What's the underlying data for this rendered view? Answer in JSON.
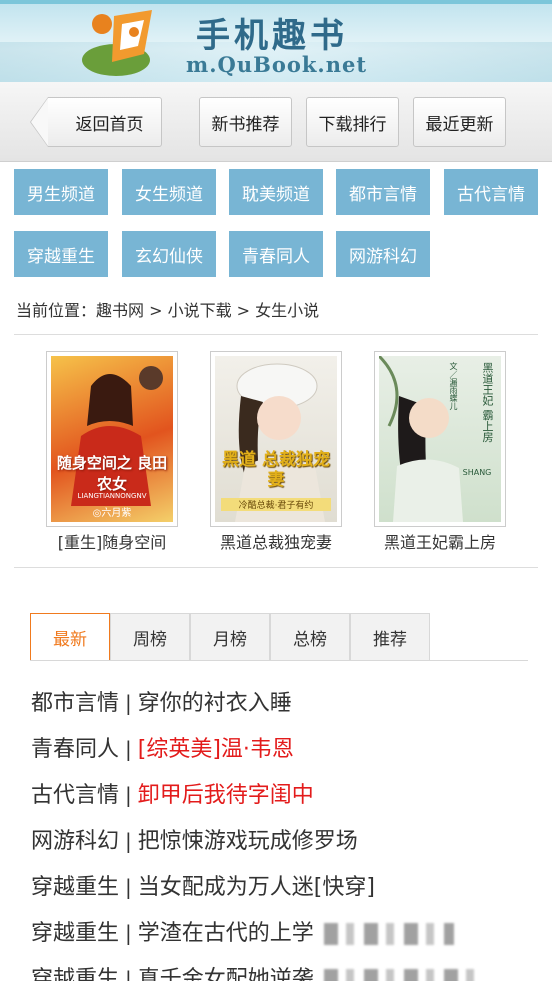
{
  "header": {
    "title": "手机趣书",
    "url": "m.QuBook.net",
    "colors": {
      "banner": "#bfe3ee",
      "brand_text": "#2f6a8a"
    }
  },
  "nav": {
    "back_label": "返回首页",
    "buttons": [
      "新书推荐",
      "下载排行",
      "最近更新"
    ]
  },
  "categories": [
    "男生频道",
    "女生频道",
    "耽美频道",
    "都市言情",
    "古代言情",
    "穿越重生",
    "玄幻仙侠",
    "青春同人",
    "网游科幻"
  ],
  "breadcrumb": "当前位置：趣书网 > 小说下载 > 女生小说",
  "books": [
    {
      "title": "[重生]随身空间",
      "cover_text": "随身空间之 良田农女",
      "cover_sub": "LIANGTIANNONGNV",
      "cover_author": "◎六月紫"
    },
    {
      "title": "黑道总裁独宠妻",
      "cover_text": "黑道 总裁独宠妻",
      "cover_sub": "冷酷总裁·君子有约"
    },
    {
      "title": "黑道王妃霸上房",
      "cover_text": "黑道王妃 霸上房",
      "cover_sub": "SHANG",
      "cover_author": "文／漏雨蝶儿"
    }
  ],
  "tabs": [
    "最新",
    "周榜",
    "月榜",
    "总榜",
    "推荐"
  ],
  "list": [
    {
      "category": "都市言情",
      "title": "穿你的衬衣入睡",
      "highlight": false
    },
    {
      "category": "青春同人",
      "title": "[综英美]温·韦恩",
      "highlight": true
    },
    {
      "category": "古代言情",
      "title": "卸甲后我待字闺中",
      "highlight": true
    },
    {
      "category": "网游科幻",
      "title": "把惊悚游戏玩成修罗场",
      "highlight": false
    },
    {
      "category": "穿越重生",
      "title": "当女配成为万人迷[快穿]",
      "highlight": false
    },
    {
      "category": "穿越重生",
      "title": "学渣在古代的上学",
      "highlight": false
    },
    {
      "category": "穿越重生",
      "title": "真千金女配她逆袭",
      "highlight": false
    }
  ],
  "colors": {
    "accent": "#f07a1e",
    "category_bg": "#78b5d4",
    "highlight": "#e31b1b"
  }
}
